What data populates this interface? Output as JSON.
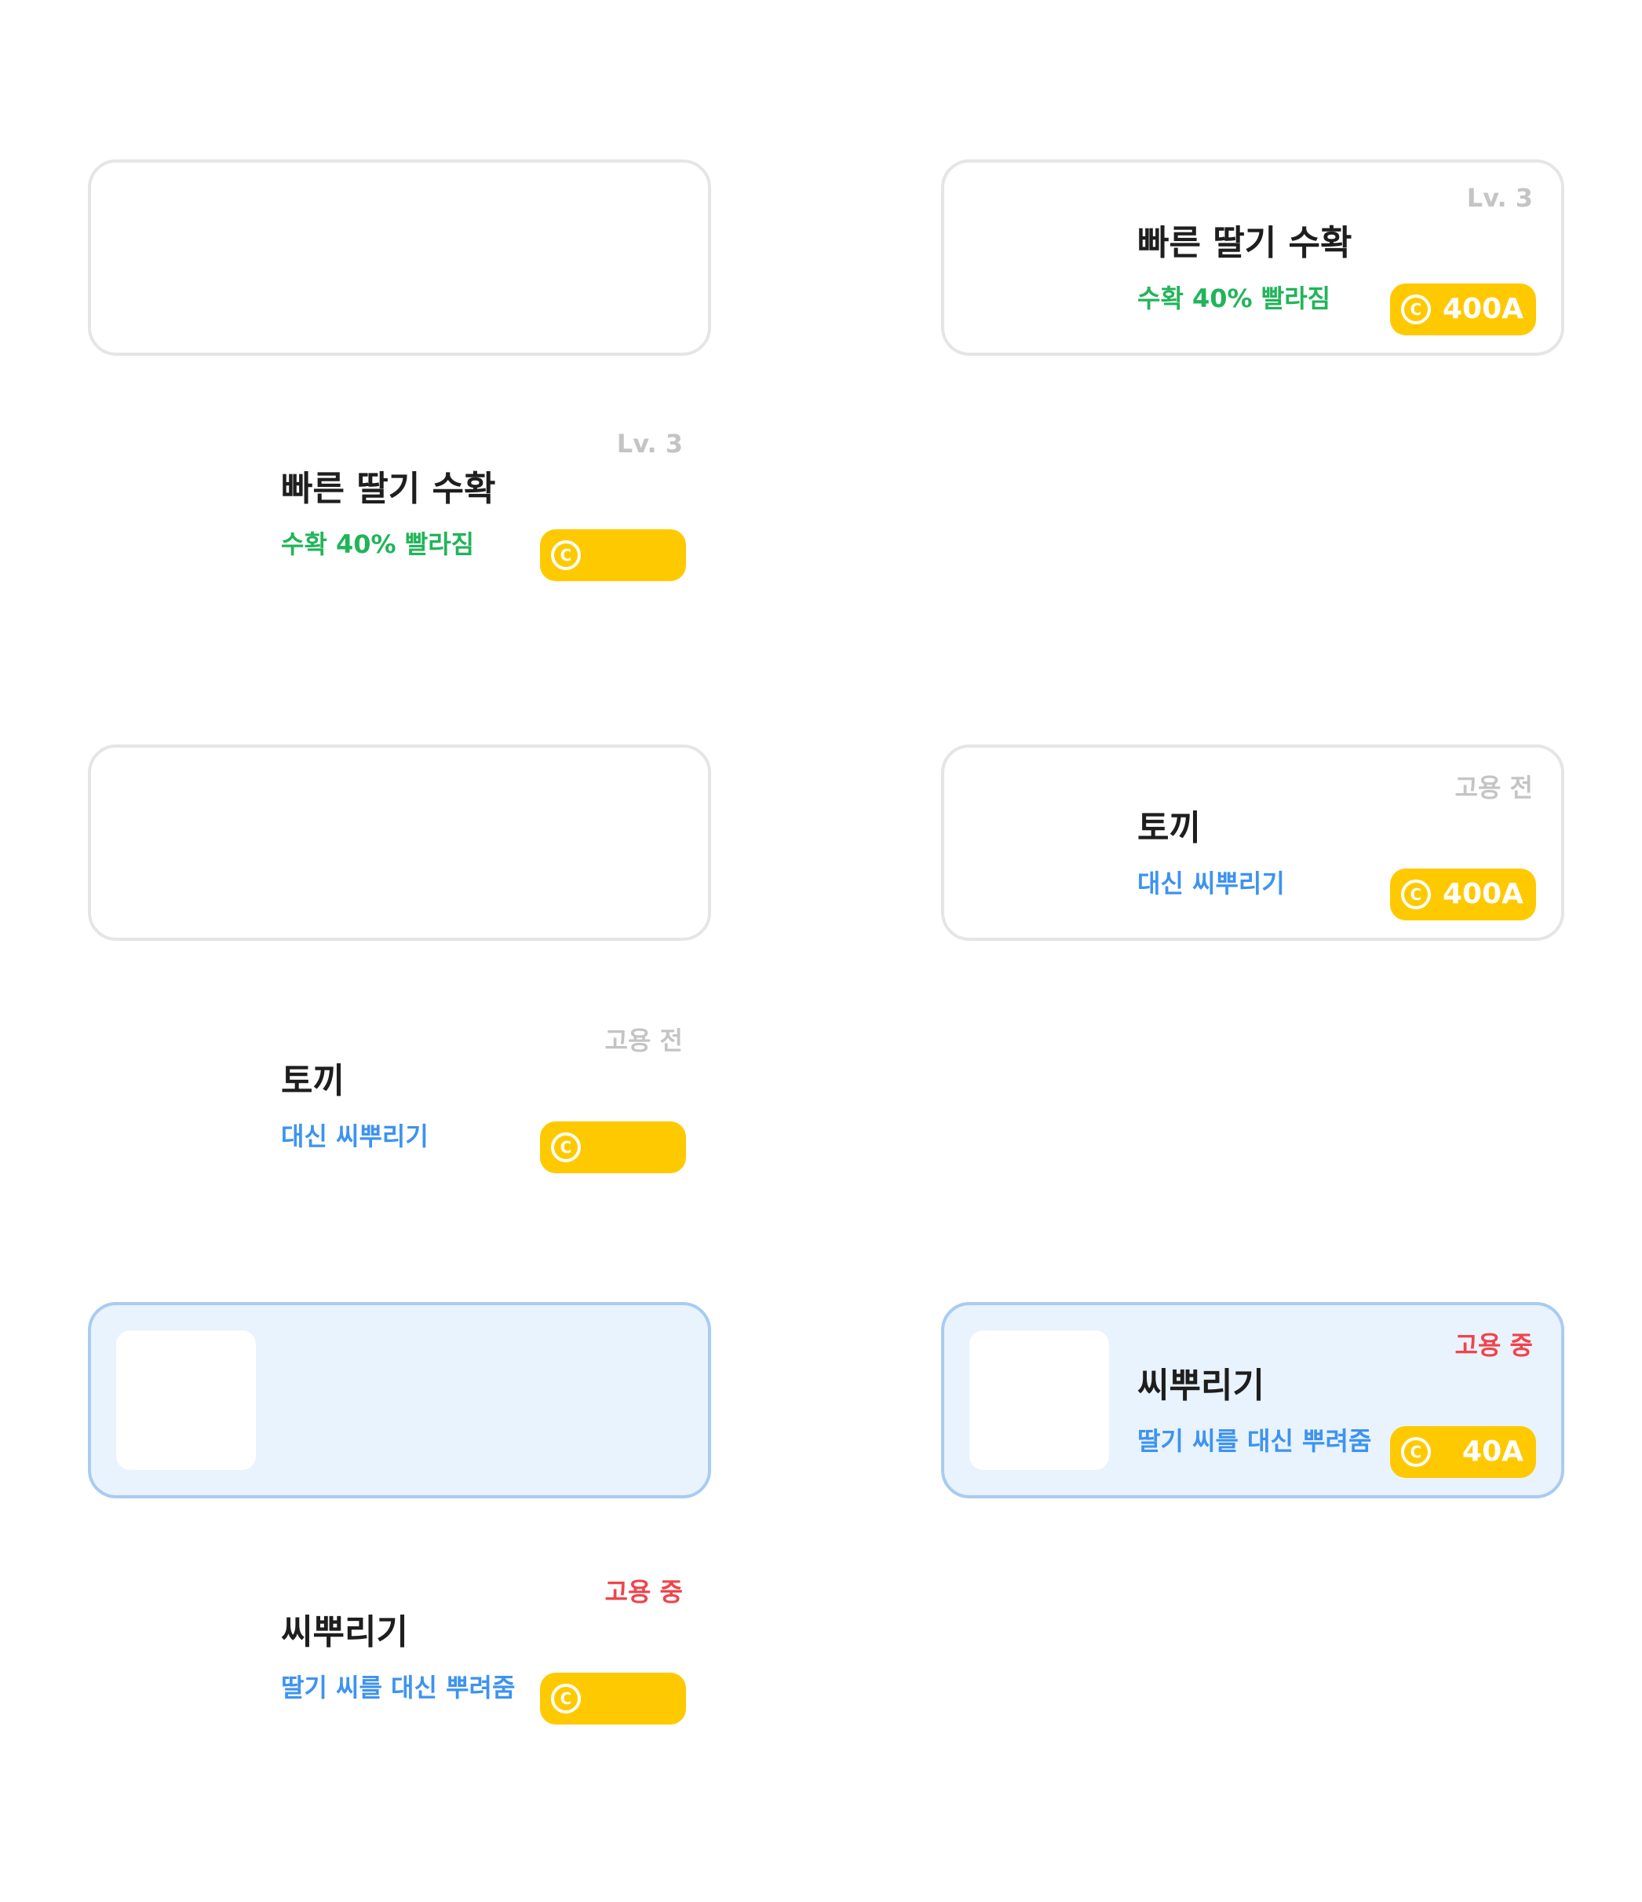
{
  "upgrade": {
    "level": "Lv. 3",
    "title": "빠른 딸기 수확",
    "description": "수확 40% 빨라짐",
    "price": "400A",
    "coin_icon": "coin-icon",
    "accent_color": "#22b45a"
  },
  "rabbit": {
    "status": "고용 전",
    "title": "토끼",
    "description": "대신 씨뿌리기",
    "price": "400A",
    "coin_icon": "coin-icon",
    "accent_color": "#3d93f0"
  },
  "seeder": {
    "status": "고용 중",
    "title": "씨뿌리기",
    "description": "딸기 씨를 대신 뿌려줌",
    "price": "40A",
    "coin_icon": "coin-icon",
    "status_color": "#f0444b"
  },
  "colors": {
    "price_badge": "#ffc900",
    "card_border": "#e5e5e5",
    "active_border": "#a8ccf2",
    "active_background": "#e9f3fd"
  }
}
